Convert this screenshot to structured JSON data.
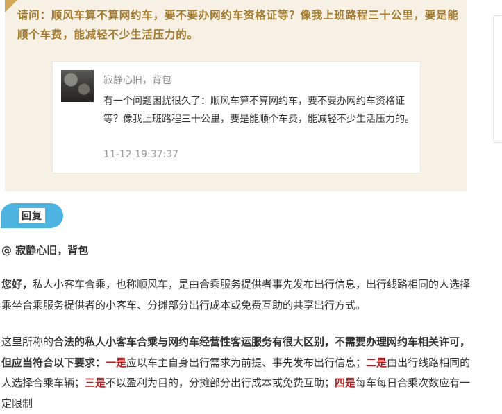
{
  "question": {
    "prefix": "请问：",
    "text": "顺风车算不算网约车，要不要办网约车资格证等？像我上班路程三十公里，要是能顺个车费，能减轻不少生活压力的。"
  },
  "quote": {
    "user": "寂静心旧，背包",
    "body": "有一个问题困扰很久了：顺风车算不算网约车，要不要办网约车资格证等？像我上班路程三十公里，要是能顺个车费，能减轻不少生活压力的。",
    "time": "11-12 19:37:37"
  },
  "reply_button": {
    "label": "回复"
  },
  "answer": {
    "mention": "@ 寂静心旧，背包",
    "para1_bold": "您好，",
    "para1_rest": "私人小客车合乘，也称顺风车，是由合乘服务提供者事先发布出行信息，出行线路相同的人选择乘坐合乘服务提供者的小客车、分摊部分出行成本或免费互助的共享出行方式。",
    "para2_lead": "这里所称的",
    "para2_bold": "合法的私人小客车合乘与网约车经营性客运服务有很大区别，不需要办理网约车相关许可，但应当符合以下要求：",
    "req1_label": "一是",
    "req1_text": "应以车主自身出行需求为前提、事先发布出行信息；",
    "req2_label": "二是",
    "req2_text": "由出行线路相同的人选择合乘车辆；",
    "req3_label": "三是",
    "req3_text": "不以盈利为目的，分摊部分出行成本或免费互助；",
    "req4_label": "四是",
    "req4_text": "每车每日合乘次数应有一定限制"
  },
  "colors": {
    "question_bg": "#f6f1e4",
    "question_text": "#a57a2c",
    "reply_button": "#4db3e0",
    "highlight_red": "#b22222"
  }
}
